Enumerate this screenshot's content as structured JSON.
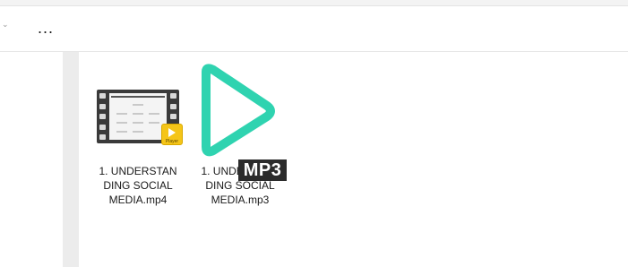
{
  "toolbar": {
    "more_label": "...",
    "expand_icon": "chevron-down-icon"
  },
  "files": [
    {
      "name": "1. UNDERSTANDING SOCIAL MEDIA.mp4",
      "type": "video",
      "icon": "video-thumbnail-icon",
      "badge_text": "Player",
      "badge_color": "#f5c518"
    },
    {
      "name": "1. UNDERSTANDING SOCIAL MEDIA.mp3",
      "type": "audio",
      "icon": "mp3-play-icon",
      "tag_text": "MP3",
      "accent_color": "#2fd3b0"
    }
  ]
}
